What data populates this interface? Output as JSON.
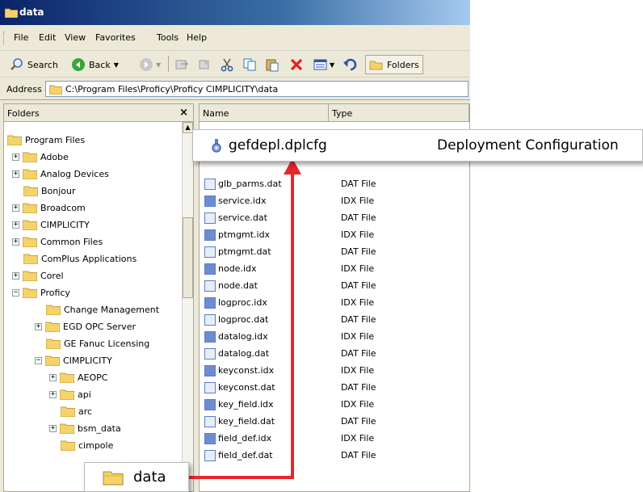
{
  "window": {
    "title": "data"
  },
  "menu": [
    "File",
    "Edit",
    "View",
    "Favorites",
    "Tools",
    "Help"
  ],
  "toolbar": {
    "search_label": "Search",
    "back_label": "Back",
    "folders_label": "Folders"
  },
  "address": {
    "label": "Address",
    "value": "C:\\Program Files\\Proficy\\Proficy CIMPLICITY\\data"
  },
  "folders_pane": {
    "title": "Folders",
    "close_glyph": "×",
    "tree": [
      {
        "label": "Program Files",
        "expander": ""
      },
      {
        "label": "Adobe",
        "expander": "+"
      },
      {
        "label": "Analog Devices",
        "expander": "+"
      },
      {
        "label": "Bonjour",
        "expander": ""
      },
      {
        "label": "Broadcom",
        "expander": "+"
      },
      {
        "label": "CIMPLICITY",
        "expander": "+"
      },
      {
        "label": "Common Files",
        "expander": "+"
      },
      {
        "label": "ComPlus Applications",
        "expander": ""
      },
      {
        "label": "Corel",
        "expander": "+"
      },
      {
        "label": "Proficy",
        "expander": "−"
      },
      {
        "label": "Change Management",
        "expander": ""
      },
      {
        "label": "EGD OPC Server",
        "expander": "+"
      },
      {
        "label": "GE Fanuc Licensing",
        "expander": ""
      },
      {
        "label": "CIMPLICITY",
        "expander": "−"
      },
      {
        "label": "AEOPC",
        "expander": "+"
      },
      {
        "label": "api",
        "expander": "+"
      },
      {
        "label": "arc",
        "expander": ""
      },
      {
        "label": "bsm_data",
        "expander": "+"
      },
      {
        "label": "cimpole",
        "expander": ""
      }
    ]
  },
  "files_pane": {
    "columns": {
      "name": "Name",
      "type": "Type"
    },
    "rows": [
      {
        "name": "glb_parms.dat",
        "type": "DAT File",
        "kind": "dat"
      },
      {
        "name": "service.idx",
        "type": "IDX File",
        "kind": "idx"
      },
      {
        "name": "service.dat",
        "type": "DAT File",
        "kind": "dat"
      },
      {
        "name": "ptmgmt.idx",
        "type": "IDX File",
        "kind": "idx"
      },
      {
        "name": "ptmgmt.dat",
        "type": "DAT File",
        "kind": "dat"
      },
      {
        "name": "node.idx",
        "type": "IDX File",
        "kind": "idx"
      },
      {
        "name": "node.dat",
        "type": "DAT File",
        "kind": "dat"
      },
      {
        "name": "logproc.idx",
        "type": "IDX File",
        "kind": "idx"
      },
      {
        "name": "logproc.dat",
        "type": "DAT File",
        "kind": "dat"
      },
      {
        "name": "datalog.idx",
        "type": "IDX File",
        "kind": "idx"
      },
      {
        "name": "datalog.dat",
        "type": "DAT File",
        "kind": "dat"
      },
      {
        "name": "keyconst.idx",
        "type": "IDX File",
        "kind": "idx"
      },
      {
        "name": "keyconst.dat",
        "type": "DAT File",
        "kind": "dat"
      },
      {
        "name": "key_field.idx",
        "type": "IDX File",
        "kind": "idx"
      },
      {
        "name": "key_field.dat",
        "type": "DAT File",
        "kind": "dat"
      },
      {
        "name": "field_def.idx",
        "type": "IDX File",
        "kind": "idx"
      },
      {
        "name": "field_def.dat",
        "type": "DAT File",
        "kind": "dat"
      }
    ]
  },
  "callouts": {
    "file": {
      "name": "gefdepl.dplcfg",
      "type": "Deployment Configuration"
    },
    "folder": {
      "label": "data"
    }
  },
  "colors": {
    "arrow": "#e8262b",
    "folder": "#f5d36a",
    "titlebar": "#0a246a"
  }
}
